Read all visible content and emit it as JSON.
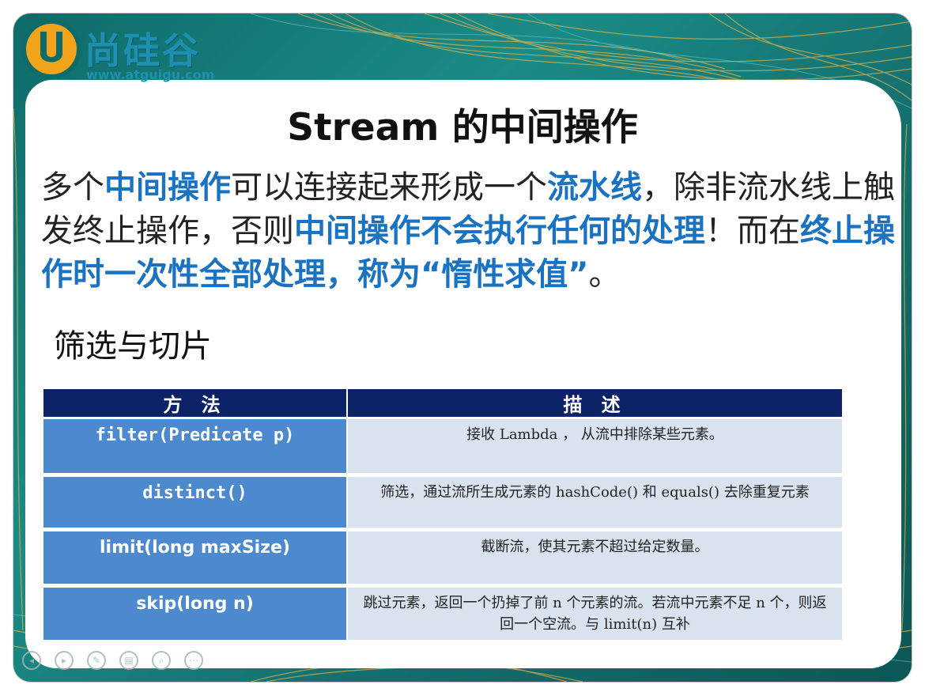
{
  "logo": {
    "brand": "尚硅谷",
    "url": "www.atguigu.com",
    "letter": "U"
  },
  "slide": {
    "title": "Stream 的中间操作",
    "paragraph": [
      {
        "text": "多个",
        "highlight": false
      },
      {
        "text": "中间操作",
        "highlight": true
      },
      {
        "text": "可以连接起来形成一个",
        "highlight": false
      },
      {
        "text": "流水线",
        "highlight": true
      },
      {
        "text": "，除非流水线上触发终止操作，否则",
        "highlight": false
      },
      {
        "text": "中间操作不会执行任何的处理",
        "highlight": true
      },
      {
        "text": "！而在",
        "highlight": false
      },
      {
        "text": "终止操作时一次性全部处理，称为“惰性求值”",
        "highlight": true
      },
      {
        "text": "。",
        "highlight": false
      }
    ],
    "subheading": "筛选与切片"
  },
  "table": {
    "headers": [
      "方 法",
      "描 述"
    ],
    "rows": [
      {
        "method": "filter(Predicate p)",
        "description": "接收 Lambda ， 从流中排除某些元素。"
      },
      {
        "method": "distinct()",
        "description": "筛选，通过流所生成元素的 hashCode() 和 equals() 去除重复元素"
      },
      {
        "method": "limit(long maxSize)",
        "description": "截断流，使其元素不超过给定数量。"
      },
      {
        "method": "skip(long n)",
        "description": "跳过元素，返回一个扔掉了前 n 个元素的流。若流中元素不足 n 个，则返回一个空流。与 limit(n) 互补"
      }
    ]
  },
  "colors": {
    "highlight": "#1a73c2",
    "header_bg": "#0c2266",
    "method_bg": "#4d89cf",
    "description_bg": "#d9e3ef",
    "frame_teal": "#1b8b86",
    "logo_orange": "#f2a31c"
  },
  "toolbar": {
    "icons": [
      "prev-icon",
      "next-icon",
      "pen-icon",
      "menu-icon",
      "zoom-icon",
      "more-icon"
    ],
    "glyphs": [
      "◂",
      "▸",
      "✎",
      "▤",
      "⌕",
      "⋯"
    ]
  }
}
